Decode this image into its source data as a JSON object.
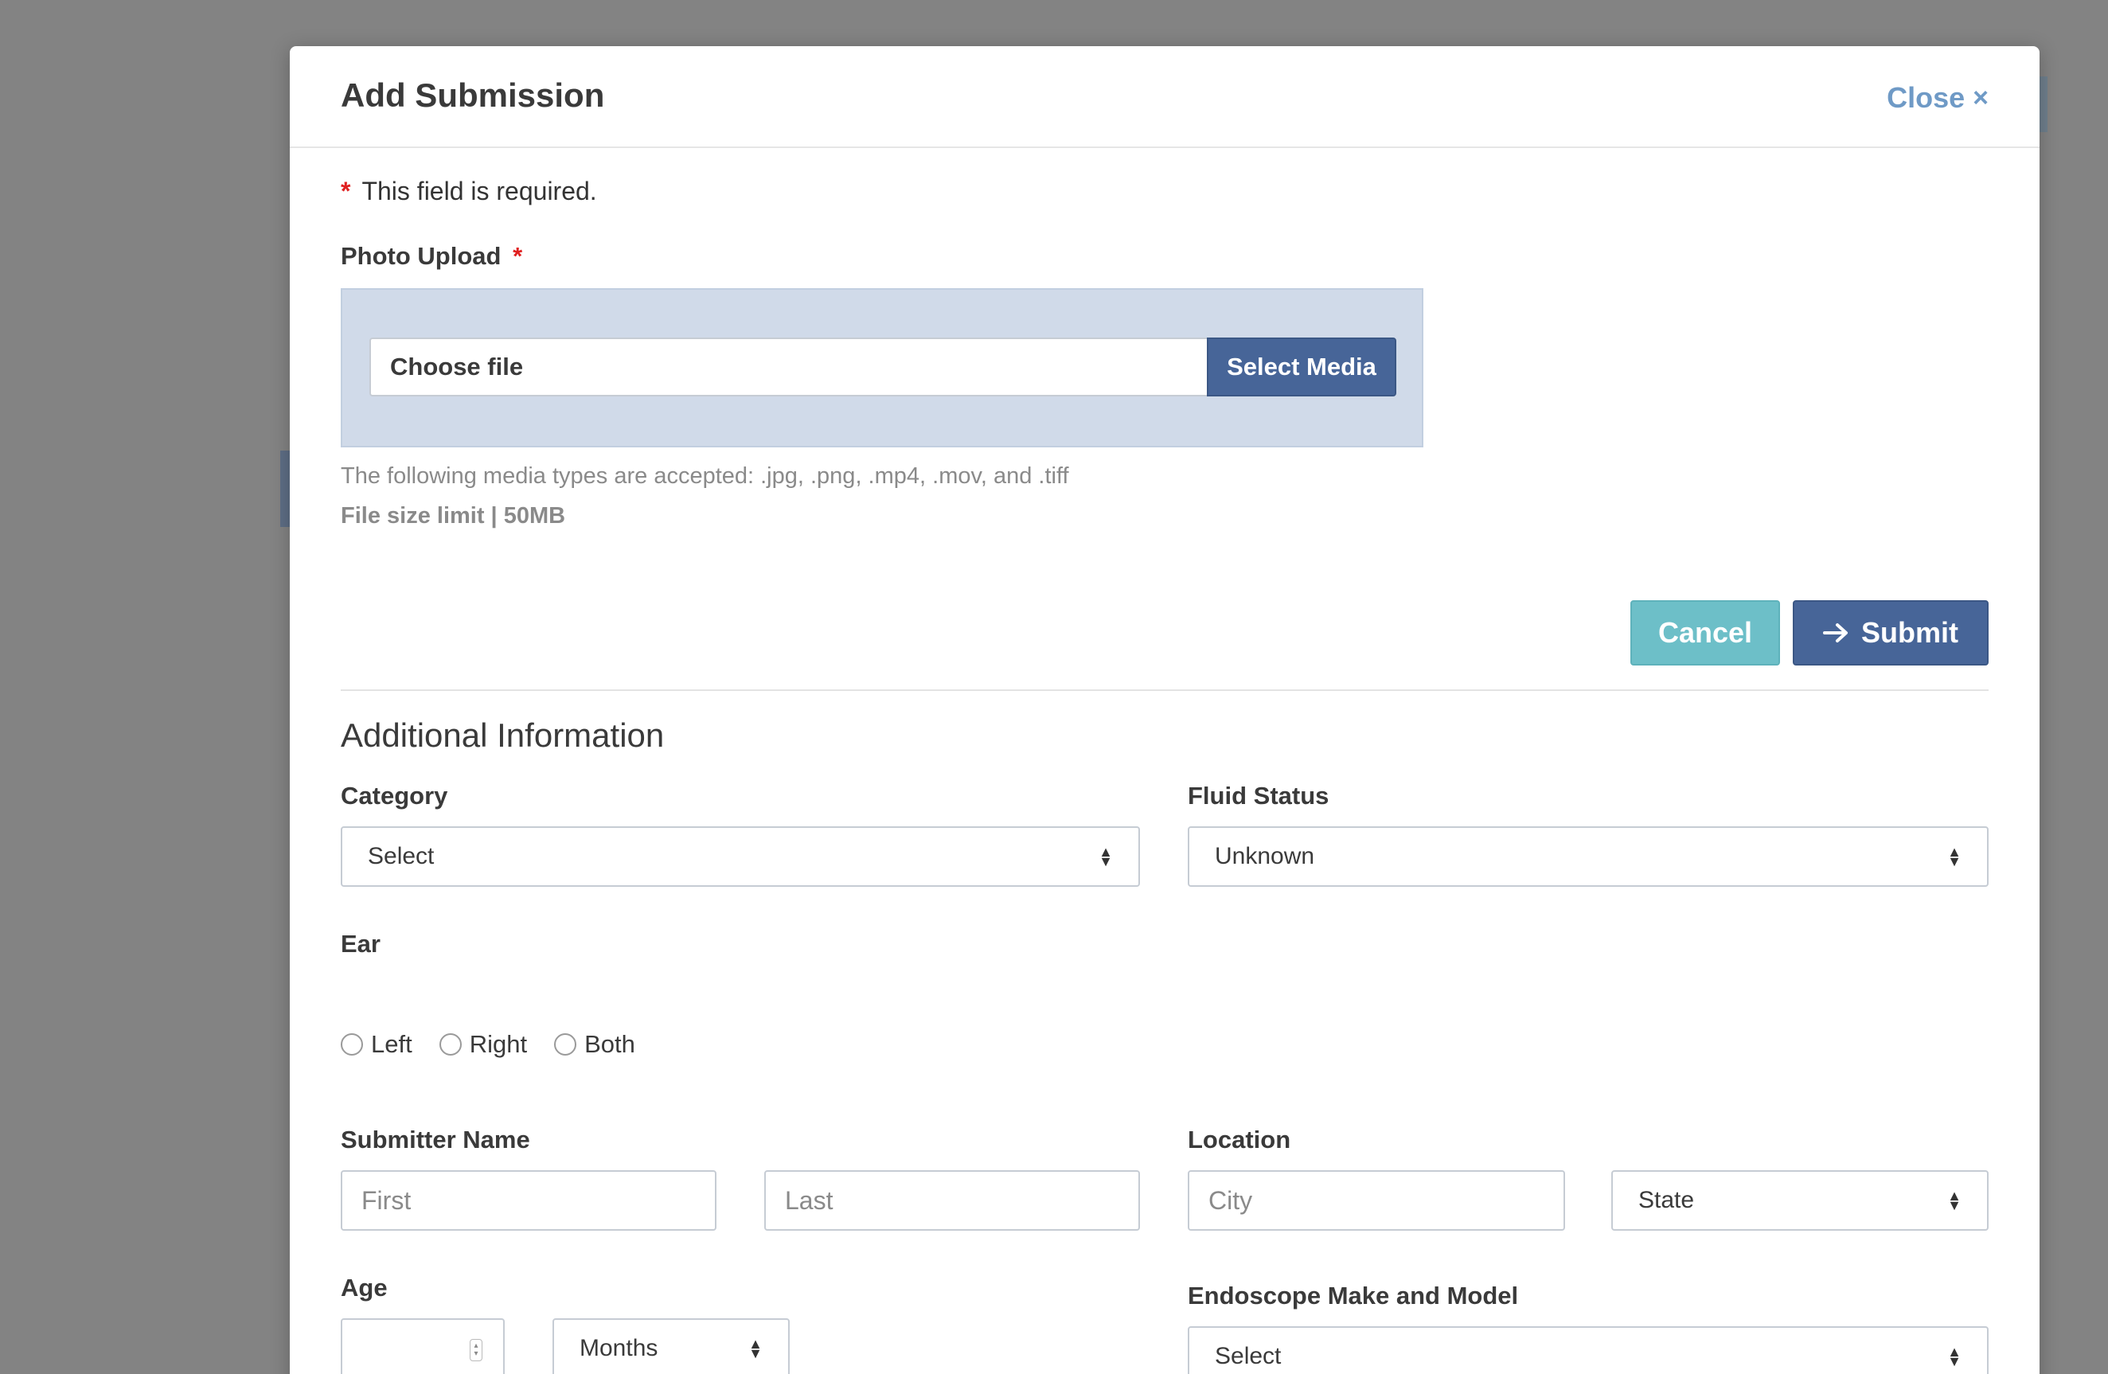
{
  "modal": {
    "title": "Add Submission",
    "close_label": "Close",
    "close_icon": "×"
  },
  "required_note": {
    "star": "*",
    "text": "This field is required."
  },
  "photo_upload": {
    "label": "Photo Upload",
    "required_star": "*",
    "file_input_text": "Choose file",
    "select_media_label": "Select Media",
    "accepted_types": "The following media types are accepted: .jpg, .png, .mp4, .mov, and .tiff",
    "size_limit": "File size limit | 50MB"
  },
  "actions": {
    "cancel_label": "Cancel",
    "submit_label": "Submit",
    "submit_icon": "arrow-right-icon"
  },
  "additional": {
    "section_title": "Additional Information",
    "category": {
      "label": "Category",
      "selected": "Select"
    },
    "fluid_status": {
      "label": "Fluid Status",
      "selected": "Unknown"
    },
    "ear": {
      "label": "Ear",
      "options": [
        "Left",
        "Right",
        "Both"
      ]
    },
    "submitter_name": {
      "label": "Submitter Name",
      "first_placeholder": "First",
      "last_placeholder": "Last"
    },
    "location": {
      "label": "Location",
      "city_placeholder": "City",
      "state_selected": "State"
    },
    "age": {
      "label": "Age",
      "value": "",
      "unit_selected": "Months"
    },
    "endoscope": {
      "label": "Endoscope Make and Model",
      "selected": "Select"
    }
  },
  "colors": {
    "primary": "#476598",
    "cancel": "#6dbfc8",
    "link": "#6f9ac6",
    "upload_bg": "#d0dae9",
    "required": "#e02020"
  }
}
